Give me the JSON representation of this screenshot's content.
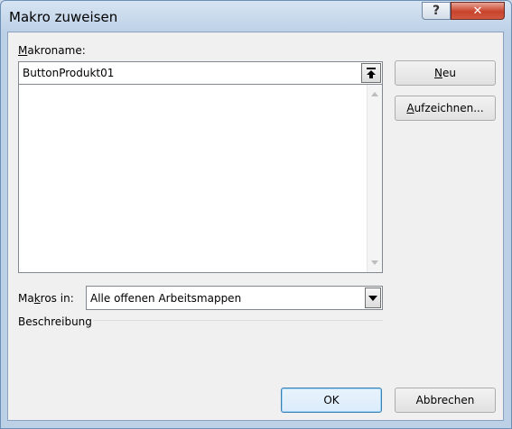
{
  "window": {
    "title": "Makro zuweisen"
  },
  "titlebar": {
    "help_label": "?",
    "close_label": "✕"
  },
  "macro_name": {
    "label_access": "M",
    "label_rest": "akroname:",
    "value": "ButtonProdukt01"
  },
  "macros_in": {
    "label_pre": "Ma",
    "label_access": "k",
    "label_post": "ros in:",
    "selected": "Alle offenen Arbeitsmappen"
  },
  "description": {
    "label": "Beschreibung"
  },
  "buttons": {
    "new_access": "N",
    "new_rest": "eu",
    "record_access": "A",
    "record_rest": "ufzeichnen...",
    "ok": "OK",
    "cancel": "Abbrechen"
  }
}
